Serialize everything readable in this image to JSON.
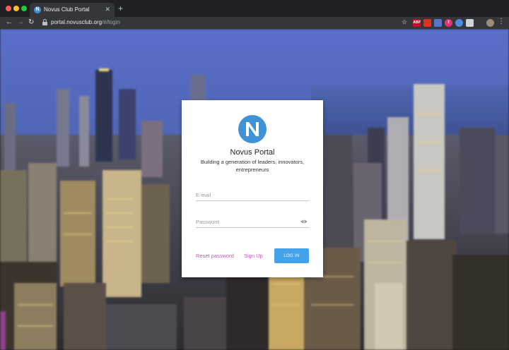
{
  "browser": {
    "tab": {
      "title": "Novus Club Portal",
      "favicon_letter": "N"
    },
    "url": {
      "host": "portal.novusclub.org",
      "path": "/#/login"
    },
    "extensions": [
      {
        "name": "abp-icon",
        "label": "ABP",
        "color": "#c70d2c"
      },
      {
        "name": "red-drop-icon",
        "label": "",
        "color": "#e0301e"
      },
      {
        "name": "badge-icon",
        "label": "",
        "color": "#5a74c9"
      },
      {
        "name": "t-icon",
        "label": "T",
        "color": "#e53371"
      },
      {
        "name": "blue-circle-icon",
        "label": "",
        "color": "#4f8be0"
      },
      {
        "name": "window-icon",
        "label": "",
        "color": "#cfd3d8"
      }
    ]
  },
  "login": {
    "title": "Novus Portal",
    "subtitle": "Building a generation of leaders, innovators, entrepreneurs",
    "email_placeholder": "E-mail",
    "password_placeholder": "Password",
    "reset_label": "Reset password",
    "signup_label": "Sign Up",
    "login_label": "LOG IN",
    "accent_color": "#44a2ea",
    "link_color": "#c552c1"
  }
}
